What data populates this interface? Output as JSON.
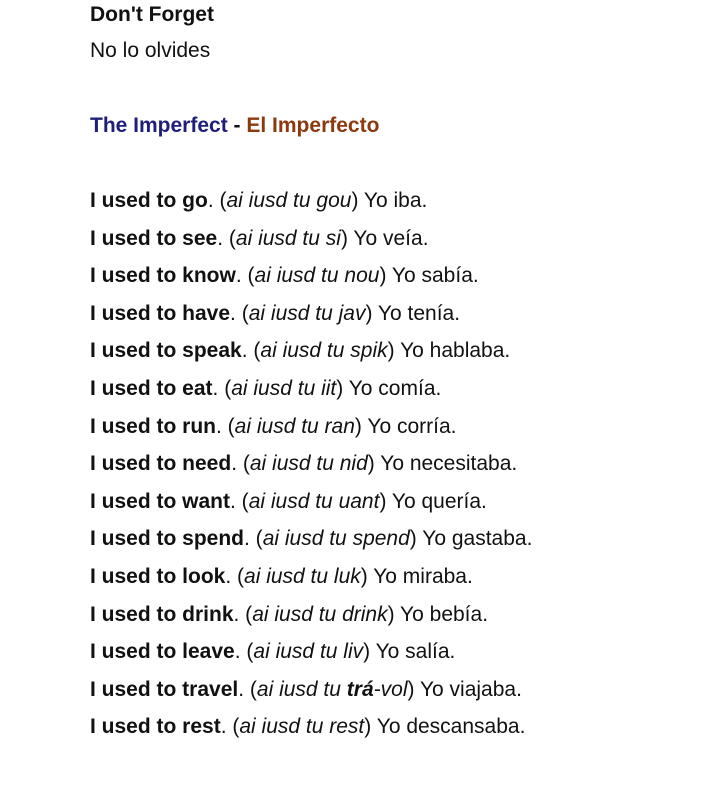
{
  "header": {
    "title": "Don't Forget",
    "subtitle": "No lo olvides"
  },
  "section": {
    "title_en": "The Imperfect",
    "separator": " - ",
    "title_es": "El Imperfecto"
  },
  "colors": {
    "title_en": "#1f1f7a",
    "title_es": "#8b3a0e"
  },
  "phrases": [
    {
      "en": "I used to go",
      "pron": "ai iusd tu gou",
      "es": "Yo iba."
    },
    {
      "en": "I used to see",
      "pron": "ai iusd tu si",
      "es": "Yo veía."
    },
    {
      "en": "I used to know",
      "pron": "ai iusd tu nou",
      "es": "Yo sabía."
    },
    {
      "en": "I used to have",
      "pron": "ai iusd tu jav",
      "es": "Yo tenía."
    },
    {
      "en": "I used to speak",
      "pron": "ai iusd tu spik",
      "es": "Yo hablaba."
    },
    {
      "en": "I used to eat",
      "pron": "ai iusd tu iit",
      "es": "Yo comía."
    },
    {
      "en": "I used to run",
      "pron": "ai iusd tu ran",
      "es": "Yo corría."
    },
    {
      "en": "I used to need",
      "pron": "ai iusd tu nid",
      "es": "Yo necesitaba."
    },
    {
      "en": "I used to want",
      "pron": "ai iusd tu uant",
      "es": "Yo quería."
    },
    {
      "en": "I used to spend",
      "pron": "ai iusd tu spend",
      "es": "Yo gastaba."
    },
    {
      "en": "I used to look",
      "pron": "ai iusd tu luk",
      "es": "Yo miraba."
    },
    {
      "en": "I used to drink",
      "pron": "ai iusd tu drink",
      "es": "Yo bebía."
    },
    {
      "en": "I used to leave",
      "pron": "ai iusd tu liv",
      "es": "Yo salía."
    },
    {
      "en": "I used to travel",
      "pron_before": "ai iusd tu ",
      "pron_stress": "trá",
      "pron_after": "-vol",
      "es": "Yo viajaba."
    },
    {
      "en": "I used to rest",
      "pron": "ai iusd tu rest",
      "es": "Yo descansaba."
    }
  ]
}
